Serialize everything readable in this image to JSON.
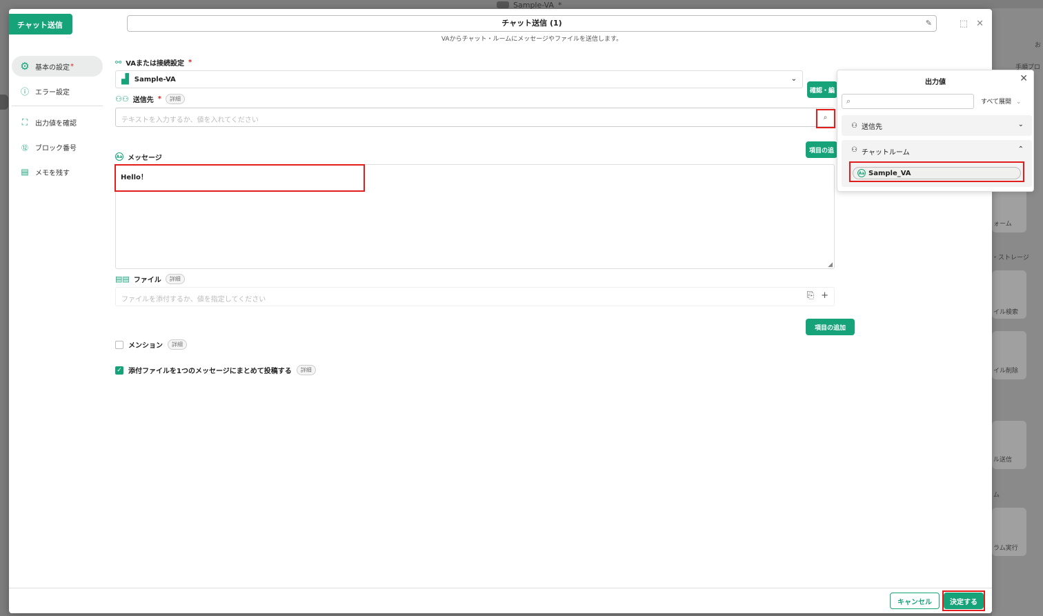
{
  "background": {
    "top_title": "Sample-VA",
    "top_asterisk": "*",
    "right_labels": [
      "お",
      "手順プロ",
      "ォーム",
      "・ストレージ",
      "イル検索",
      "イル削除",
      "ル送信",
      "ム",
      "ラム実行"
    ]
  },
  "modal": {
    "tag": "チャット送信",
    "title": "チャット送信 (1)",
    "subtitle": "VAからチャット・ルームにメッセージやファイルを送信します。"
  },
  "sidebar": {
    "items": [
      {
        "label": "基本の設定",
        "required": "*",
        "icon": "gear-icon"
      },
      {
        "label": "エラー設定",
        "icon": "alert-circle-icon"
      },
      {
        "label": "出力値を確認",
        "icon": "bracket-frame-icon"
      },
      {
        "label": "ブロック番号",
        "icon": "number-circle-icon"
      },
      {
        "label": "メモを残す",
        "icon": "memo-icon"
      }
    ]
  },
  "form": {
    "connection": {
      "label": "VAまたは接続設定",
      "required": "*",
      "value": "Sample-VA",
      "button": "確認・編"
    },
    "recipient": {
      "label": "送信先",
      "required": "*",
      "detail": "詳細",
      "placeholder": "テキストを入力するか、値を入れてください",
      "add_button": "項目の追"
    },
    "message": {
      "label": "メッセージ",
      "value": "Hello！"
    },
    "file": {
      "label": "ファイル",
      "detail": "詳細",
      "placeholder": "ファイルを添付するか、値を指定してください",
      "add_button": "項目の追加"
    },
    "mention": {
      "label": "メンション",
      "detail": "詳細",
      "checked": false
    },
    "bundle": {
      "label": "添付ファイルを1つのメッセージにまとめて投稿する",
      "detail": "詳細",
      "checked": true
    }
  },
  "popover": {
    "title": "出力値",
    "expand_all": "すべて展開",
    "sections": [
      {
        "label": "送信先",
        "expanded": false
      },
      {
        "label": "チャットルーム",
        "expanded": true,
        "items": [
          "Sample_VA"
        ]
      }
    ]
  },
  "footer": {
    "cancel": "キャンセル",
    "confirm": "決定する"
  },
  "colors": {
    "accent": "#16a37a",
    "highlight": "#e21b1b"
  }
}
